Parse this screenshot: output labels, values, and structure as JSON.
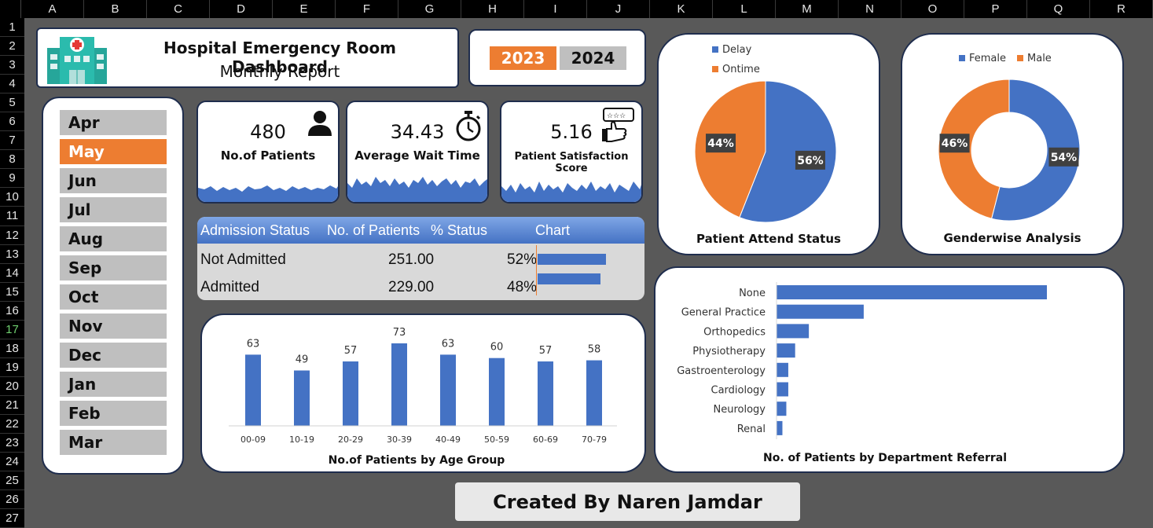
{
  "sheet": {
    "columns": [
      "A",
      "B",
      "C",
      "D",
      "E",
      "F",
      "G",
      "H",
      "I",
      "J",
      "K",
      "L",
      "M",
      "N",
      "O",
      "P",
      "Q",
      "R"
    ],
    "rows": [
      "1",
      "2",
      "3",
      "4",
      "5",
      "6",
      "7",
      "8",
      "9",
      "10",
      "11",
      "12",
      "13",
      "14",
      "15",
      "16",
      "17",
      "18",
      "19",
      "20",
      "21",
      "22",
      "23",
      "24",
      "25",
      "26",
      "27"
    ],
    "selected_row": "17"
  },
  "header": {
    "title": "Hospital Emergency Room Dashboard",
    "subtitle": "Monthly Report"
  },
  "years": {
    "active": "2023",
    "inactive": "2024"
  },
  "months": [
    "Apr",
    "May",
    "Jun",
    "Jul",
    "Aug",
    "Sep",
    "Oct",
    "Nov",
    "Dec",
    "Jan",
    "Feb",
    "Mar"
  ],
  "active_month": "May",
  "kpis": {
    "patients": {
      "value": "480",
      "label": "No.of Patients",
      "icon": "person-icon"
    },
    "wait": {
      "value": "34.43",
      "label": "Average Wait Time",
      "icon": "stopwatch-icon"
    },
    "satisfaction": {
      "value": "5.16",
      "label": "Patient Satisfaction Score",
      "icon": "rating-hand-icon"
    }
  },
  "admission": {
    "headers": [
      "Admission Status",
      "No. of Patients",
      "% Status",
      "Chart"
    ],
    "rows": [
      {
        "status": "Not Admitted",
        "patients": "251.00",
        "pct": "52%",
        "share": 0.52
      },
      {
        "status": "Admitted",
        "patients": "229.00",
        "pct": "48%",
        "share": 0.48
      }
    ]
  },
  "colors": {
    "blue": "#4472c4",
    "orange": "#ed7d31",
    "navy": "#1f2d4d"
  },
  "chart_data": [
    {
      "type": "pie",
      "title": "Patient Attend Status",
      "categories": [
        "Delay",
        "Ontime"
      ],
      "values": [
        56,
        44
      ],
      "labels": [
        "56%",
        "44%"
      ],
      "colors": [
        "#4472c4",
        "#ed7d31"
      ],
      "legend": "top-left"
    },
    {
      "type": "pie",
      "title": "Genderwise Analysis",
      "categories": [
        "Female",
        "Male"
      ],
      "values": [
        54,
        46
      ],
      "labels": [
        "54%",
        "46%"
      ],
      "colors": [
        "#4472c4",
        "#ed7d31"
      ],
      "legend": "top"
    },
    {
      "type": "bar",
      "title": "No.of Patients by Age Group",
      "categories": [
        "00-09",
        "10-19",
        "20-29",
        "30-39",
        "40-49",
        "50-59",
        "60-69",
        "70-79"
      ],
      "values": [
        63,
        49,
        57,
        73,
        63,
        60,
        57,
        58
      ],
      "ylim": [
        0,
        80
      ]
    },
    {
      "type": "bar",
      "orientation": "horizontal",
      "title": "No.  of Patients by Department Referral",
      "categories": [
        "None",
        "General Practice",
        "Orthopedics",
        "Physiotherapy",
        "Gastroenterology",
        "Cardiology",
        "Neurology",
        "Renal"
      ],
      "values": [
        276,
        89,
        33,
        19,
        12,
        12,
        10,
        6
      ]
    }
  ],
  "credit": "Created By Naren Jamdar"
}
